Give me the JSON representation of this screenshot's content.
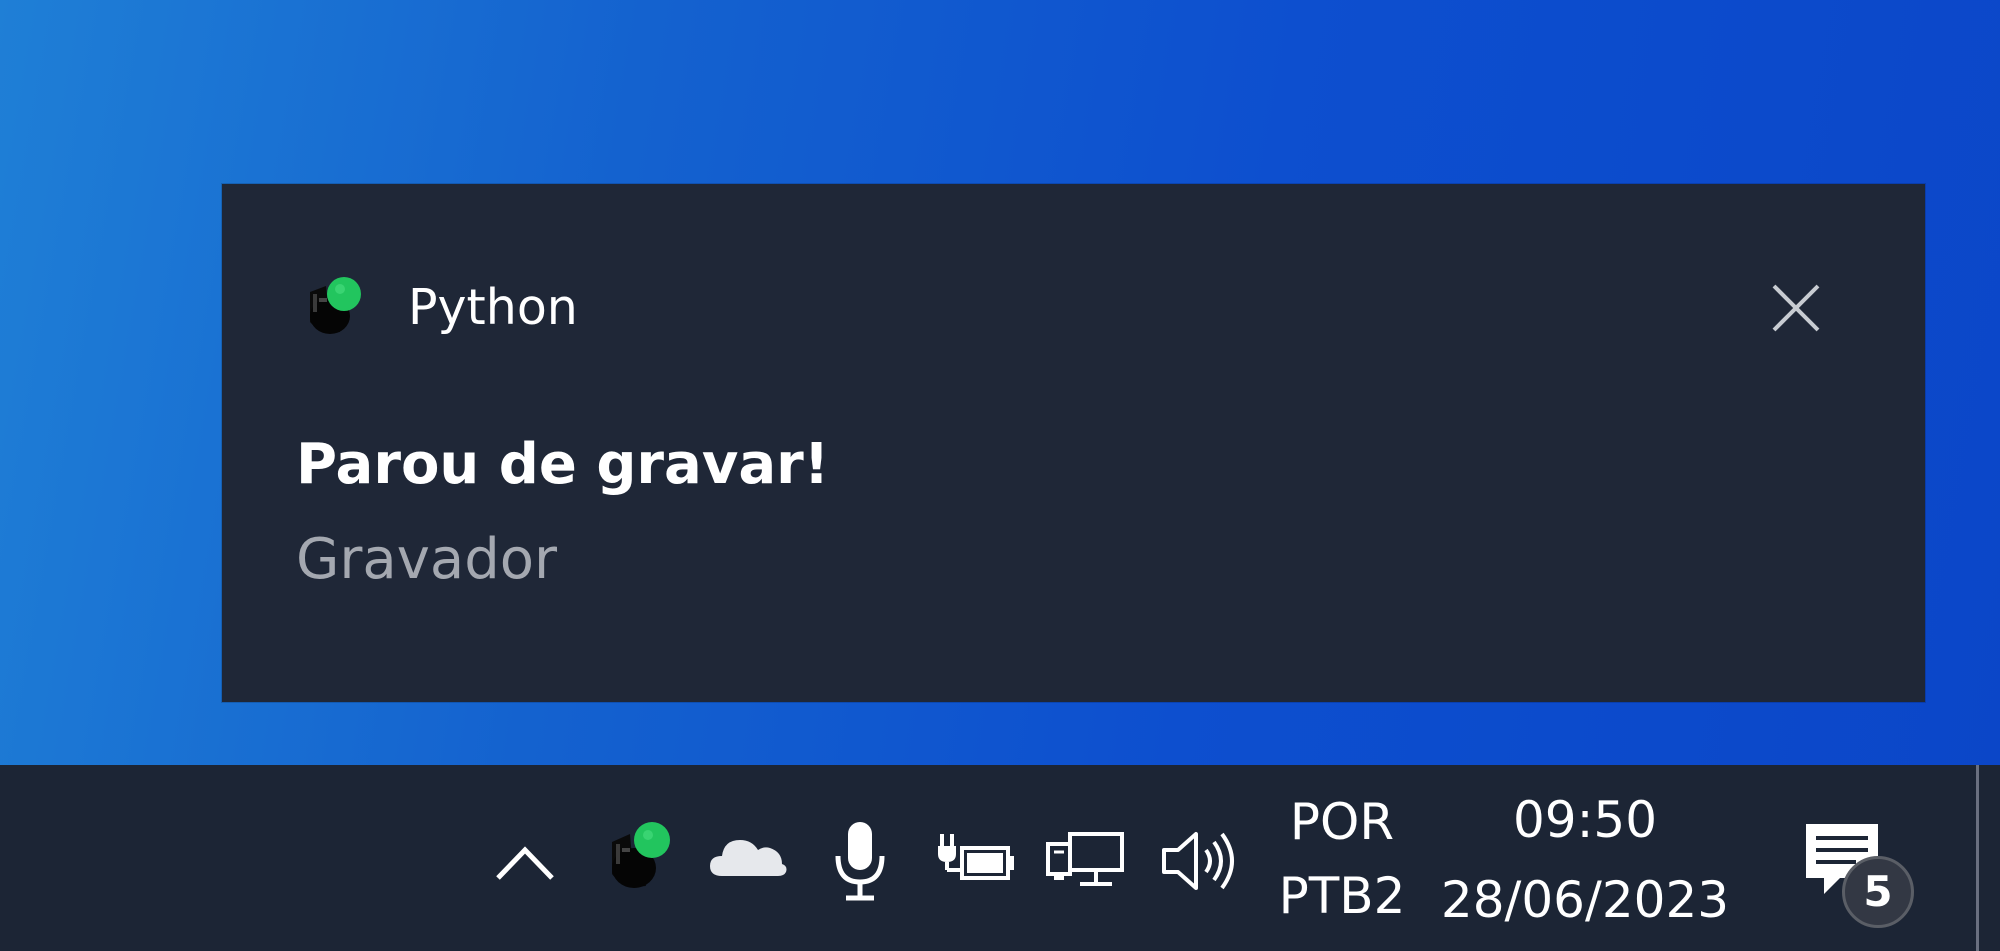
{
  "toast": {
    "app_name": "Python",
    "app_icon": "python-recorder-icon",
    "title": "Parou de gravar!",
    "body": "Gravador",
    "close_icon": "close-icon"
  },
  "taskbar": {
    "tray_icons": [
      "chevron-up-icon",
      "python-recorder-icon",
      "onedrive-cloud-icon",
      "microphone-icon",
      "battery-charging-icon",
      "network-icon",
      "volume-icon"
    ],
    "language": {
      "line1": "POR",
      "line2": "PTB2"
    },
    "clock": {
      "time": "09:50",
      "date": "28/06/2023"
    },
    "notifications": {
      "icon": "action-center-icon",
      "count": "5"
    }
  },
  "colors": {
    "toast_background": "#1f2737",
    "taskbar_background": "#1c2535",
    "desktop_blue": "#0d4fcf",
    "app_icon_green": "#22c55e",
    "body_text_gray": "#a4a8b0"
  }
}
